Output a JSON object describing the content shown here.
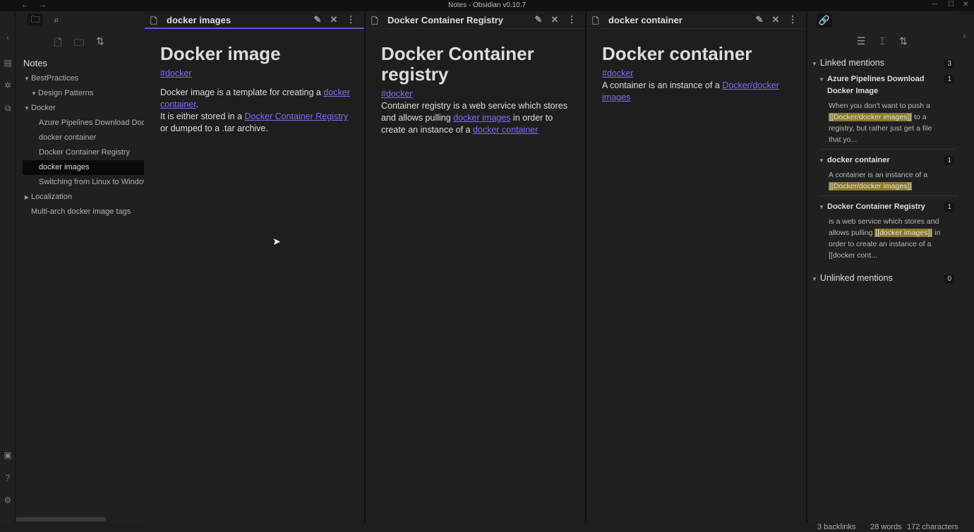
{
  "window": {
    "title": "Notes - Obsidian v0.10.7"
  },
  "left_sidebar": {
    "vault_name": "Notes",
    "tree": [
      {
        "label": "BestPractices",
        "type": "folder",
        "expanded": true,
        "level": 0
      },
      {
        "label": "Design Patterns",
        "type": "folder",
        "expanded": true,
        "level": 1
      },
      {
        "label": "Docker",
        "type": "folder",
        "expanded": true,
        "level": 0
      },
      {
        "label": "Azure Pipelines Download Docker Image",
        "type": "file",
        "level": 1
      },
      {
        "label": "docker container",
        "type": "file",
        "level": 1
      },
      {
        "label": "Docker Container Registry",
        "type": "file",
        "level": 1
      },
      {
        "label": "docker images",
        "type": "file",
        "level": 1,
        "active": true
      },
      {
        "label": "Switching from Linux to Windows",
        "type": "file",
        "level": 1
      },
      {
        "label": "Localization",
        "type": "folder",
        "expanded": false,
        "level": 0
      },
      {
        "label": "Multi-arch docker image tags",
        "type": "file",
        "level": 0
      }
    ]
  },
  "panes": [
    {
      "tab_title": "docker images",
      "heading": "Docker image",
      "tag": "#docker",
      "p1_text": "Docker image is a template for creating a ",
      "p1_link": "docker container",
      "p1_end": ".",
      "p2_text": "It is either stored in a ",
      "p2_link": "Docker Container Registry",
      "p2_end": "or dumped to a .tar archive."
    },
    {
      "tab_title": "Docker Container Registry",
      "heading": "Docker Container registry",
      "tag": "#docker",
      "p1_text": "Container registry is a web service which stores and allows pulling ",
      "p1_link": "docker images",
      "p1_mid": " in order to create an instance of a ",
      "p1_link2": "docker container"
    },
    {
      "tab_title": "docker container",
      "heading": "Docker container",
      "tag": "#docker",
      "p1_text": "A container is an instance of a ",
      "p1_link": "Docker/docker images"
    }
  ],
  "backlinks": {
    "linked_title": "Linked mentions",
    "linked_count": "3",
    "items": [
      {
        "title": "Azure Pipelines Download Docker Image",
        "count": "1",
        "snip_pre": "When you don't want to push a ",
        "snip_hl": "[[Docker/docker images]]",
        "snip_post": " to a registry, but rather just get a file that yo..."
      },
      {
        "title": "docker container",
        "count": "1",
        "snip_pre": "A container is an instance of a ",
        "snip_hl": "[[Docker/docker images]]",
        "snip_post": ""
      },
      {
        "title": "Docker Container Registry",
        "count": "1",
        "snip_pre": "is a web service which stores and allows pulling ",
        "snip_hl": "[[docker images]]",
        "snip_post": " in order to create an instance of a [[docker cont..."
      }
    ],
    "unlinked_title": "Unlinked mentions",
    "unlinked_count": "0"
  },
  "status": {
    "backlinks": "3 backlinks",
    "words": "28 words",
    "chars": "172 characters"
  }
}
